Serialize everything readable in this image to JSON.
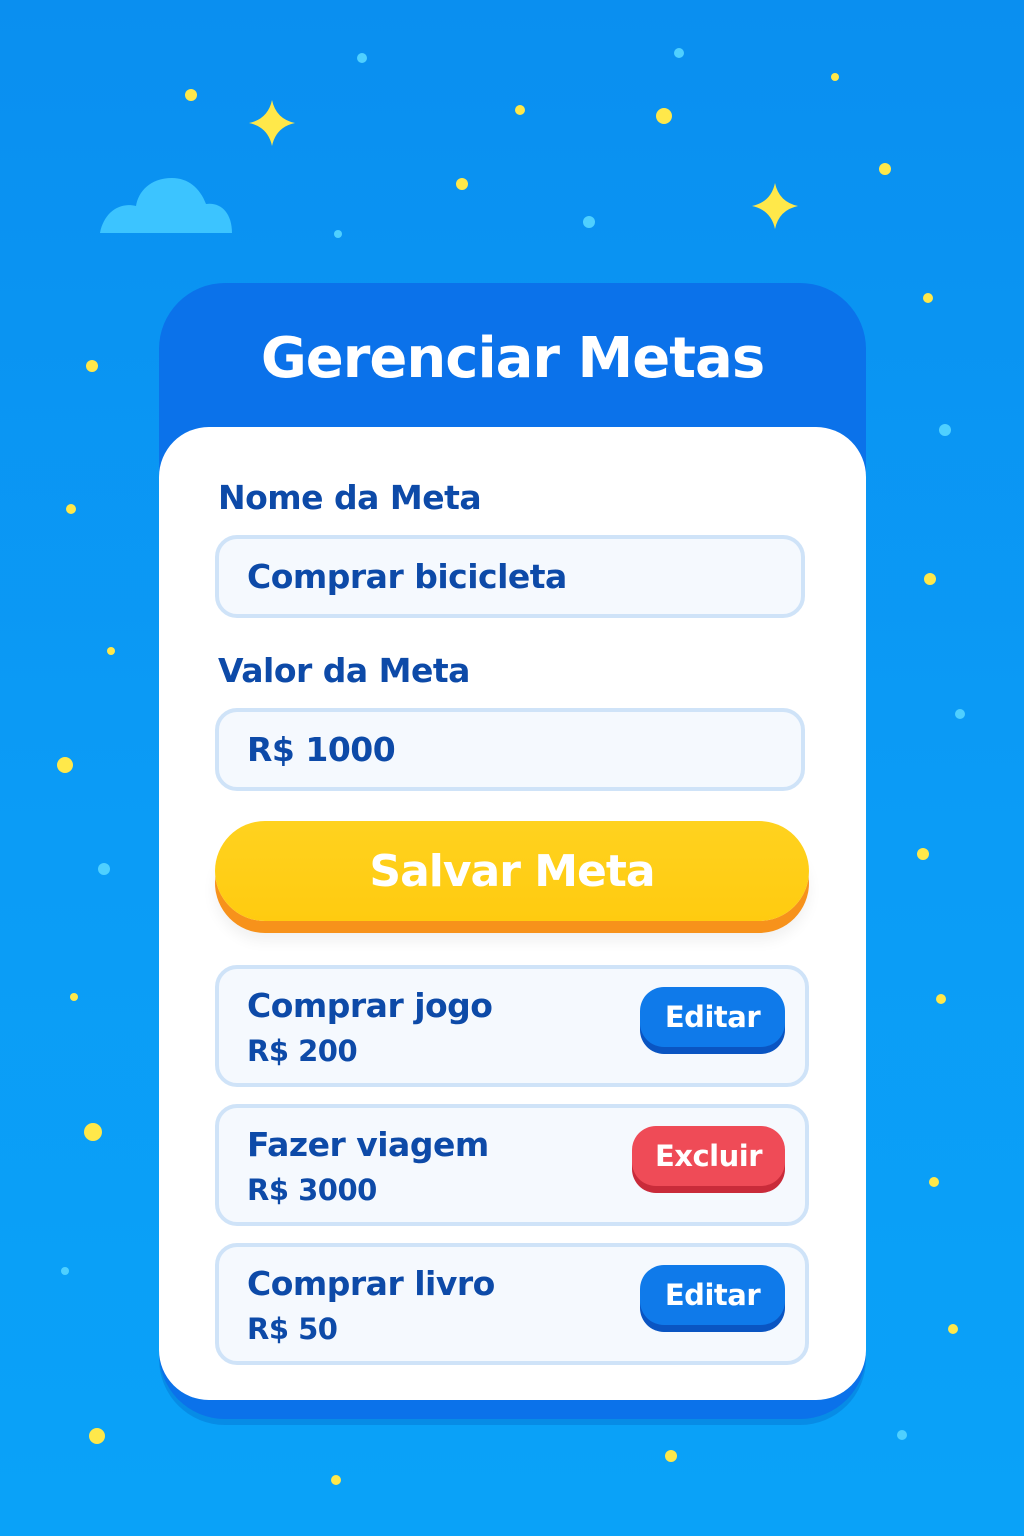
{
  "page": {
    "title": "Gerenciar Metas"
  },
  "form": {
    "name_label": "Nome da Meta",
    "name_value": "Comprar bicicleta",
    "value_label": "Valor da Meta",
    "value_value": "R$ 1000",
    "save_label": "Salvar Meta"
  },
  "goals": [
    {
      "name": "Comprar jogo",
      "value": "R$ 200",
      "action": "Editar"
    },
    {
      "name": "Fazer viagem",
      "value": "R$ 3000",
      "action": "Excluir"
    },
    {
      "name": "Comprar livro",
      "value": "R$ 50",
      "action": "Editar"
    }
  ],
  "colors": {
    "background": "#0b9cf6",
    "header": "#0b72ea",
    "text": "#0d4aa8",
    "save_button": "#ffcb10",
    "edit_button": "#0f7aea",
    "delete_button": "#ef4b57",
    "star": "#ffe84a"
  },
  "icons": {
    "decorations": [
      "star-icon",
      "cloud-icon"
    ]
  }
}
